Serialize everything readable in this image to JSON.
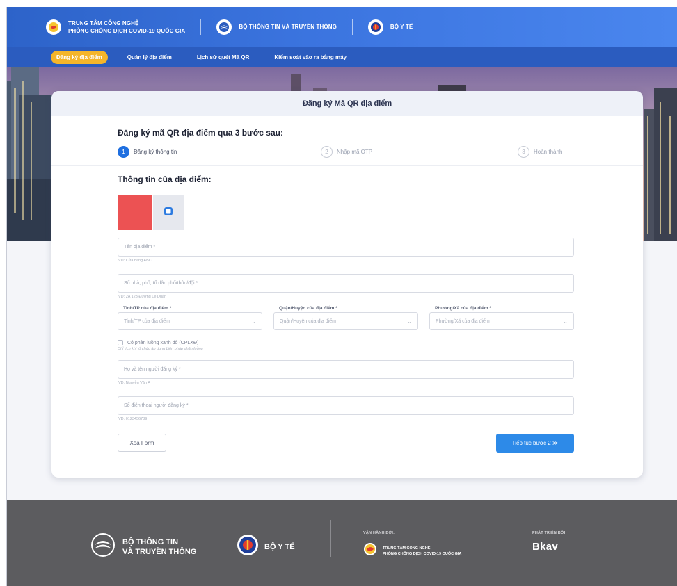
{
  "header": {
    "brand_line1": "TRUNG TÂM CÔNG NGHỆ",
    "brand_line2": "PHÒNG CHỐNG DỊCH COVID-19 QUỐC GIA",
    "ministry_ict": "BỘ THÔNG TIN VÀ TRUYỀN THÔNG",
    "ministry_health": "BỘ Y TẾ"
  },
  "nav": {
    "items": [
      {
        "label": "Đăng ký địa điểm",
        "active": true
      },
      {
        "label": "Quản lý địa điểm",
        "active": false
      },
      {
        "label": "Lịch sử quét Mã QR",
        "active": false
      },
      {
        "label": "Kiểm soát vào ra bằng máy",
        "active": false
      }
    ]
  },
  "card": {
    "title": "Đăng ký Mã QR địa điểm",
    "steps_title": "Đăng ký mã QR địa điểm qua 3 bước sau:",
    "steps": [
      {
        "num": "1",
        "label": "Đăng ký thông tin",
        "active": true
      },
      {
        "num": "2",
        "label": "Nhập mã OTP",
        "active": false
      },
      {
        "num": "3",
        "label": "Hoàn thành",
        "active": false
      }
    ],
    "section_title": "Thông tin của địa điểm:",
    "fields": {
      "place_name": {
        "placeholder": "Tên địa điểm *",
        "hint": "VD: Cửa hàng ABC"
      },
      "address": {
        "placeholder": "Số nhà, phố, tổ dân phố/thôn/đội *",
        "hint": "VD: 2A 123 Đường Lê Duẩn"
      },
      "province": {
        "label": "Tỉnh/TP của địa điểm *",
        "placeholder": "Tỉnh/TP của địa điểm"
      },
      "district": {
        "label": "Quận/Huyện của địa điểm *",
        "placeholder": "Quận/Huyện của địa điểm"
      },
      "ward": {
        "label": "Phường/Xã của địa điểm *",
        "placeholder": "Phường/Xã của địa điểm"
      },
      "checkbox_label": "Có phân luồng xanh đỏ (CPLXĐ)",
      "checkbox_note": "Chỉ tích khi tổ chức áp dụng biện pháp phân luồng",
      "registrant_name": {
        "placeholder": "Họ và tên người đăng ký *",
        "hint": "VD: Nguyễn Văn A"
      },
      "registrant_phone": {
        "placeholder": "Số điện thoại người đăng ký *",
        "hint": "VD: 0123456789"
      }
    },
    "buttons": {
      "clear": "Xóa Form",
      "next": "Tiếp tục bước 2 ≫"
    }
  },
  "footer": {
    "ict_line1": "BỘ THÔNG TIN",
    "ict_line2": "VÀ TRUYỀN THÔNG",
    "health": "BỘ Y TẾ",
    "operated_by": "VẬN HÀNH BỞI:",
    "op_line1": "TRUNG TÂM CÔNG NGHỆ",
    "op_line2": "PHÒNG CHỐNG DỊCH COVID-19 QUỐC GIA",
    "developed_by": "PHÁT TRIỂN BỞI:",
    "developer": "Bkav"
  },
  "colors": {
    "header_blue": "#3b74df",
    "nav_blue": "#2b5cbf",
    "nav_active": "#f5b52a",
    "primary_button": "#2d8ae8",
    "footer_bg": "#5c5c5f",
    "image_placeholder_red": "#ec5253"
  },
  "icons": [
    "covid-center-logo-icon",
    "ministry-ict-logo-icon",
    "ministry-health-logo-icon",
    "add-image-icon",
    "chevron-down-icon"
  ]
}
